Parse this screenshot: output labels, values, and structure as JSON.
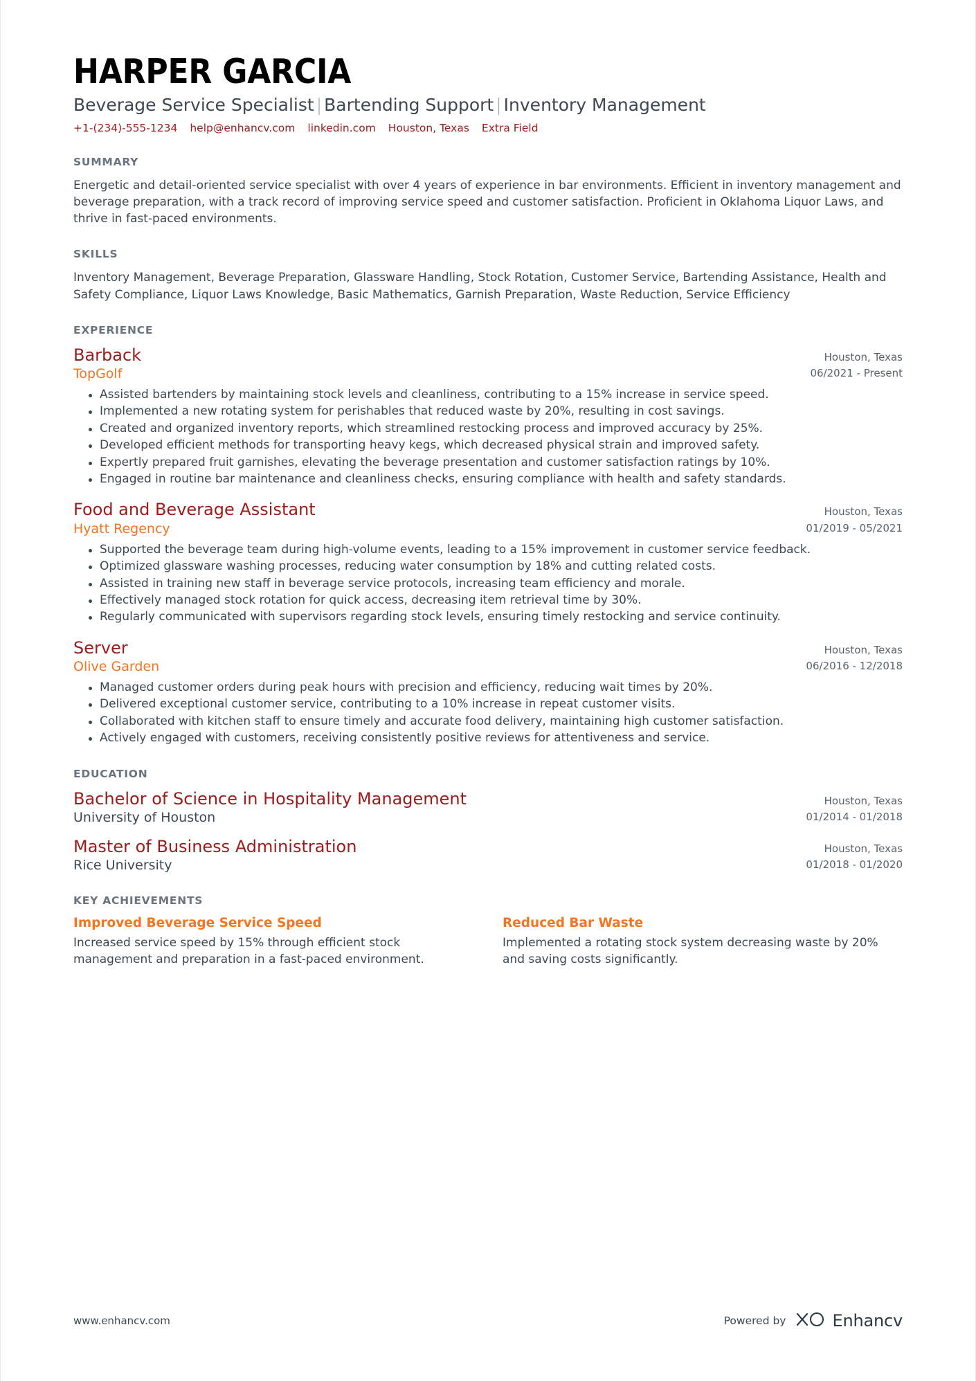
{
  "header": {
    "name": "HARPER GARCIA",
    "headline_parts": [
      "Beverage Service Specialist",
      "Bartending Support",
      "Inventory Management"
    ],
    "contact": {
      "phone": "+1-(234)-555-1234",
      "email": "help@enhancv.com",
      "linkedin": "linkedin.com",
      "location": "Houston, Texas",
      "extra": "Extra Field"
    }
  },
  "summary": {
    "title": "SUMMARY",
    "text": "Energetic and detail-oriented service specialist with over 4 years of experience in bar environments. Efficient in inventory management and beverage preparation, with a track record of improving service speed and customer satisfaction. Proficient in Oklahoma Liquor Laws, and thrive in fast-paced environments."
  },
  "skills": {
    "title": "SKILLS",
    "text": "Inventory Management, Beverage Preparation, Glassware Handling, Stock Rotation, Customer Service, Bartending Assistance, Health and Safety Compliance, Liquor Laws Knowledge, Basic Mathematics, Garnish Preparation, Waste Reduction, Service Efficiency"
  },
  "experience": {
    "title": "EXPERIENCE",
    "entries": [
      {
        "role": "Barback",
        "company": "TopGolf",
        "location": "Houston, Texas",
        "dates": "06/2021 - Present",
        "bullets": [
          "Assisted bartenders by maintaining stock levels and cleanliness, contributing to a 15% increase in service speed.",
          "Implemented a new rotating system for perishables that reduced waste by 20%, resulting in cost savings.",
          "Created and organized inventory reports, which streamlined restocking process and improved accuracy by 25%.",
          "Developed efficient methods for transporting heavy kegs, which decreased physical strain and improved safety.",
          "Expertly prepared fruit garnishes, elevating the beverage presentation and customer satisfaction ratings by 10%.",
          "Engaged in routine bar maintenance and cleanliness checks, ensuring compliance with health and safety standards."
        ]
      },
      {
        "role": "Food and Beverage Assistant",
        "company": "Hyatt Regency",
        "location": "Houston, Texas",
        "dates": "01/2019 - 05/2021",
        "bullets": [
          "Supported the beverage team during high-volume events, leading to a 15% improvement in customer service feedback.",
          "Optimized glassware washing processes, reducing water consumption by 18% and cutting related costs.",
          "Assisted in training new staff in beverage service protocols, increasing team efficiency and morale.",
          "Effectively managed stock rotation for quick access, decreasing item retrieval time by 30%.",
          "Regularly communicated with supervisors regarding stock levels, ensuring timely restocking and service continuity."
        ]
      },
      {
        "role": "Server",
        "company": "Olive Garden",
        "location": "Houston, Texas",
        "dates": "06/2016 - 12/2018",
        "bullets": [
          "Managed customer orders during peak hours with precision and efficiency, reducing wait times by 20%.",
          "Delivered exceptional customer service, contributing to a 10% increase in repeat customer visits.",
          "Collaborated with kitchen staff to ensure timely and accurate food delivery, maintaining high customer satisfaction.",
          "Actively engaged with customers, receiving consistently positive reviews for attentiveness and service."
        ]
      }
    ]
  },
  "education": {
    "title": "EDUCATION",
    "entries": [
      {
        "degree": "Bachelor of Science in Hospitality Management",
        "school": "University of Houston",
        "location": "Houston, Texas",
        "dates": "01/2014 - 01/2018"
      },
      {
        "degree": "Master of Business Administration",
        "school": "Rice University",
        "location": "Houston, Texas",
        "dates": "01/2018 - 01/2020"
      }
    ]
  },
  "achievements": {
    "title": "KEY ACHIEVEMENTS",
    "items": [
      {
        "title": "Improved Beverage Service Speed",
        "description": "Increased service speed by 15% through efficient stock management and preparation in a fast-paced environment."
      },
      {
        "title": "Reduced Bar Waste",
        "description": "Implemented a rotating stock system decreasing waste by 20% and saving costs significantly."
      }
    ]
  },
  "footer": {
    "url": "www.enhancv.com",
    "powered_by": "Powered by",
    "brand": "Enhancv"
  },
  "colors": {
    "accent_red": "#9e1b1b",
    "accent_orange": "#f4741f",
    "heading_gray": "#6a7480",
    "body_gray": "#3d4852"
  }
}
